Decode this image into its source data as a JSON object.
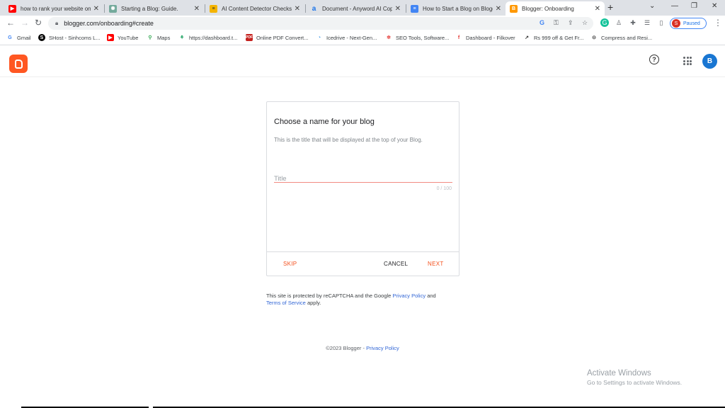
{
  "tabs": [
    {
      "title": "how to rank your website on",
      "icon": "youtube-icon",
      "color": "#ff0000"
    },
    {
      "title": "Starting a Blog: Guide.",
      "icon": "chatgpt-icon",
      "color": "#74aa9c"
    },
    {
      "title": "AI Content Detector Checks",
      "icon": "content-detector-icon",
      "color": "#f4b400"
    },
    {
      "title": "Document - Anyword AI Cop",
      "icon": "anyword-icon",
      "color": "#1a73e8"
    },
    {
      "title": "How to Start a Blog on Blogg",
      "icon": "docs-icon",
      "color": "#4285f4"
    },
    {
      "title": "Blogger: Onboarding",
      "icon": "blogger-icon",
      "color": "#ff5722"
    }
  ],
  "browser": {
    "url": "blogger.com/onboarding#create",
    "profile_initial": "S",
    "profile_status": "Paused"
  },
  "bookmarks": [
    {
      "label": "Gmail",
      "icon": "google-icon",
      "color": "#4285f4"
    },
    {
      "label": "SHost - Sinhcoms L...",
      "icon": "shost-icon",
      "color": "#000000"
    },
    {
      "label": "YouTube",
      "icon": "youtube-icon",
      "color": "#ff0000"
    },
    {
      "label": "Maps",
      "icon": "maps-icon",
      "color": "#34a853"
    },
    {
      "label": "https://dashboard.t...",
      "icon": "dashboard-icon",
      "color": "#0f9d58"
    },
    {
      "label": "Online PDF Convert...",
      "icon": "pdf-icon",
      "color": "#c5221f"
    },
    {
      "label": "Icedrive - Next-Gen...",
      "icon": "icedrive-icon",
      "color": "#1e88e5"
    },
    {
      "label": "SEO Tools, Software...",
      "icon": "seo-icon",
      "color": "#e53935"
    },
    {
      "label": "Dashboard - Filkover",
      "icon": "facebook-icon",
      "color": "#e53935"
    },
    {
      "label": "Rs 999 off & Get Fr...",
      "icon": "trend-icon",
      "color": "#333333"
    },
    {
      "label": "Compress and Resi...",
      "icon": "compress-icon",
      "color": "#444444"
    }
  ],
  "blogger": {
    "user_initial": "B",
    "brand_color": "#ff5722"
  },
  "dialog": {
    "heading": "Choose a name for your blog",
    "description": "This is the title that will be displayed at the top of your Blog.",
    "title_placeholder": "Title",
    "counter": "0 / 100",
    "skip": "SKIP",
    "cancel": "CANCEL",
    "next": "NEXT"
  },
  "recaptcha": {
    "text1": "This site is protected by reCAPTCHA and the Google ",
    "privacy": "Privacy Policy",
    "and": " and",
    "terms": "Terms of Service",
    "apply": " apply."
  },
  "footer": {
    "copyright": "©2023 Blogger - ",
    "privacy": "Privacy Policy"
  },
  "watermark": {
    "title": "Activate Windows",
    "subtitle": "Go to Settings to activate Windows."
  }
}
